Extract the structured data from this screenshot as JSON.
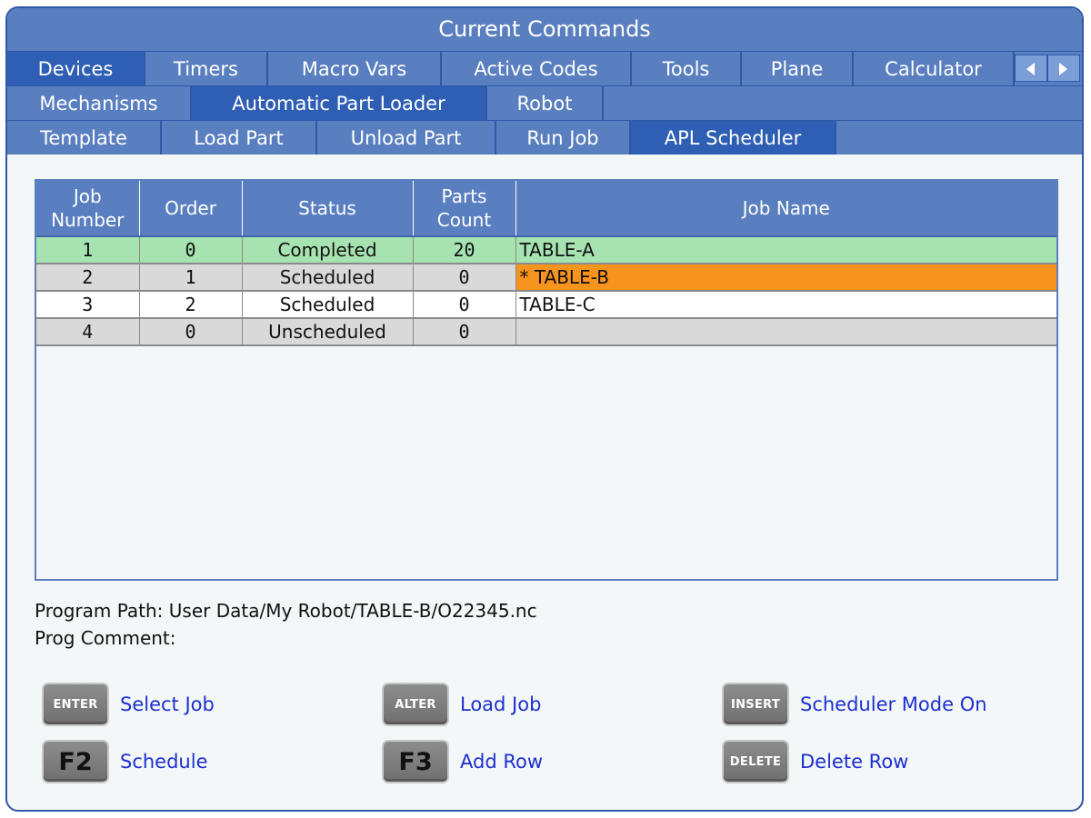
{
  "window": {
    "title": "Current Commands"
  },
  "tabs_row1": [
    {
      "label": "Devices",
      "active": true
    },
    {
      "label": "Timers"
    },
    {
      "label": "Macro Vars"
    },
    {
      "label": "Active Codes"
    },
    {
      "label": "Tools"
    },
    {
      "label": "Plane"
    },
    {
      "label": "Calculator"
    }
  ],
  "tabs_row2": [
    {
      "label": "Mechanisms"
    },
    {
      "label": "Automatic Part Loader",
      "active": true
    },
    {
      "label": "Robot"
    }
  ],
  "tabs_row3": [
    {
      "label": "Template"
    },
    {
      "label": "Load Part"
    },
    {
      "label": "Unload Part"
    },
    {
      "label": "Run Job"
    },
    {
      "label": "APL Scheduler",
      "active": true
    }
  ],
  "table": {
    "headers": [
      "Job Number",
      "Order",
      "Status",
      "Parts Count",
      "Job Name"
    ],
    "rows": [
      {
        "job": "1",
        "order": "0",
        "status": "Completed",
        "parts": "20",
        "name": "TABLE-A"
      },
      {
        "job": "2",
        "order": "1",
        "status": "Scheduled",
        "parts": "0",
        "name": "* TABLE-B"
      },
      {
        "job": "3",
        "order": "2",
        "status": "Scheduled",
        "parts": "0",
        "name": "TABLE-C"
      },
      {
        "job": "4",
        "order": "0",
        "status": "Unscheduled",
        "parts": "0",
        "name": ""
      }
    ]
  },
  "info": {
    "program_path": "Program Path: User Data/My Robot/TABLE-B/O22345.nc",
    "prog_comment": "Prog Comment:"
  },
  "keys": [
    {
      "key": "ENTER",
      "label": "Select Job"
    },
    {
      "key": "ALTER",
      "label": "Load Job"
    },
    {
      "key": "INSERT",
      "label": "Scheduler Mode On"
    },
    {
      "key": "F2",
      "label": "Schedule"
    },
    {
      "key": "F3",
      "label": "Add Row"
    },
    {
      "key": "DELETE",
      "label": "Delete Row"
    }
  ],
  "colors": {
    "header_blue": "#5a7fc0",
    "active_tab": "#2f5fb4",
    "completed_row": "#a7e3b1",
    "selected_job": "#f7941d",
    "key_label": "#1c2fd0"
  }
}
